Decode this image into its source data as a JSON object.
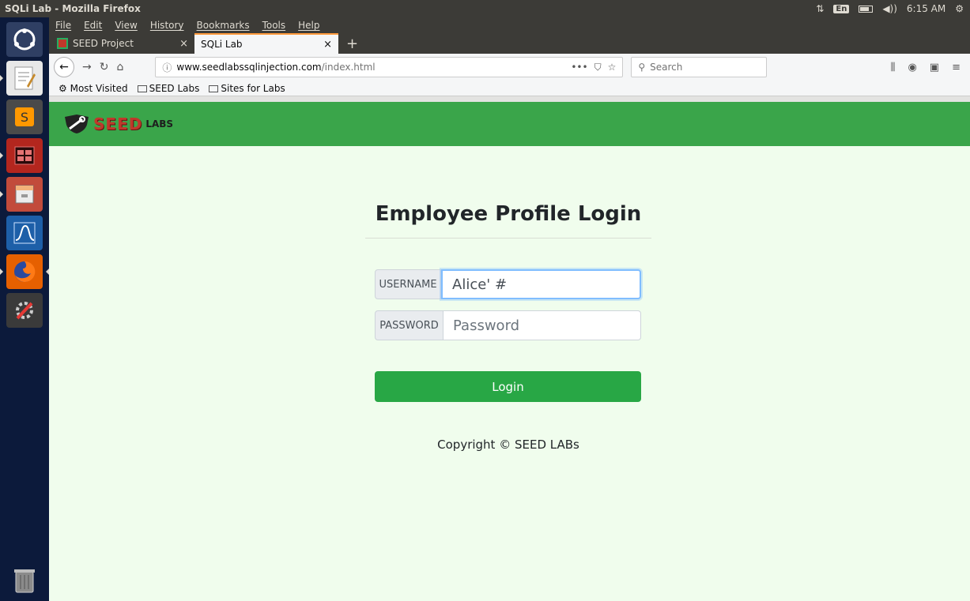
{
  "window": {
    "title": "SQLi Lab - Mozilla Firefox"
  },
  "tray": {
    "keyboard": "En",
    "time": "6:15 AM"
  },
  "menubar": {
    "items": [
      "File",
      "Edit",
      "View",
      "History",
      "Bookmarks",
      "Tools",
      "Help"
    ]
  },
  "tabs": [
    {
      "label": "SEED Project",
      "close": "×"
    },
    {
      "label": "SQLi Lab",
      "close": "×"
    }
  ],
  "newtab": "+",
  "url": {
    "host": "www.seedlabssqlinjection.com",
    "path": "/index.html",
    "info": "ⓘ"
  },
  "search": {
    "placeholder": "Search"
  },
  "bookmarks": {
    "most_visited": "Most Visited",
    "seed_labs": "SEED Labs",
    "sites_for_labs": "Sites for Labs"
  },
  "page": {
    "logo_text": "SEED",
    "logo_sub": "LABS",
    "heading": "Employee Profile Login",
    "username_label": "USERNAME",
    "username_value": "Alice' #",
    "password_label": "PASSWORD",
    "password_placeholder": "Password",
    "login_label": "Login",
    "copyright": "Copyright © SEED LABs"
  },
  "colors": {
    "header_green": "#3aa54a",
    "page_bg": "#f0fded",
    "button_green": "#28a745",
    "launcher": "#0c1a3b"
  }
}
